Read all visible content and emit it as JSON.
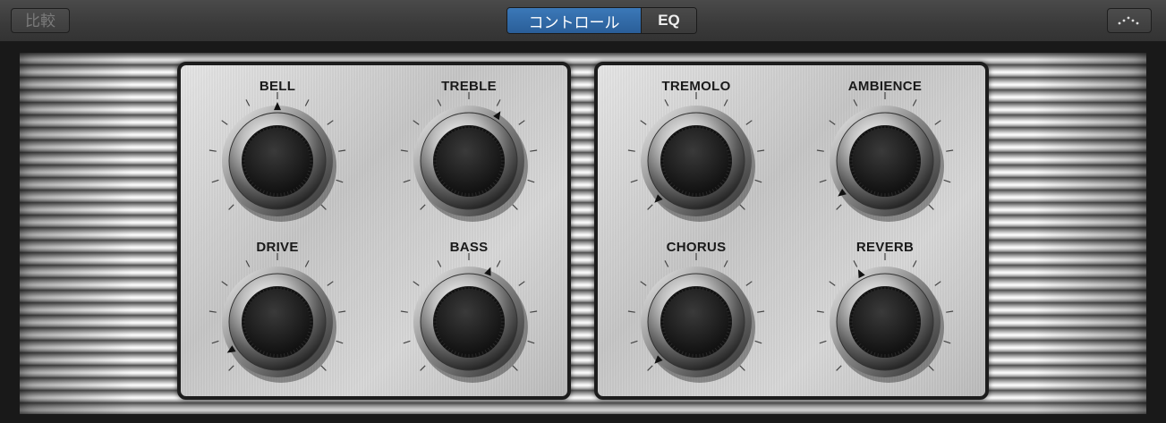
{
  "header": {
    "compare_label": "比較",
    "tabs": [
      {
        "label": "コントロール",
        "active": true
      },
      {
        "label": "EQ",
        "active": false
      }
    ],
    "menu_icon": "dots-menu-icon"
  },
  "controls": [
    {
      "name": "bell",
      "label": "BELL",
      "value": 0.5
    },
    {
      "name": "treble",
      "label": "TREBLE",
      "value": 0.62
    },
    {
      "name": "drive",
      "label": "DRIVE",
      "value": 0.05
    },
    {
      "name": "bass",
      "label": "BASS",
      "value": 0.58
    },
    {
      "name": "tremolo",
      "label": "TREMOLO",
      "value": 0.0
    },
    {
      "name": "ambience",
      "label": "AMBIENCE",
      "value": 0.03
    },
    {
      "name": "chorus",
      "label": "CHORUS",
      "value": 0.0
    },
    {
      "name": "reverb",
      "label": "REVERB",
      "value": 0.4
    }
  ],
  "colors": {
    "accent": "#2f6aa8",
    "plate": "#d4d4d4",
    "label": "#1a1a1a"
  }
}
